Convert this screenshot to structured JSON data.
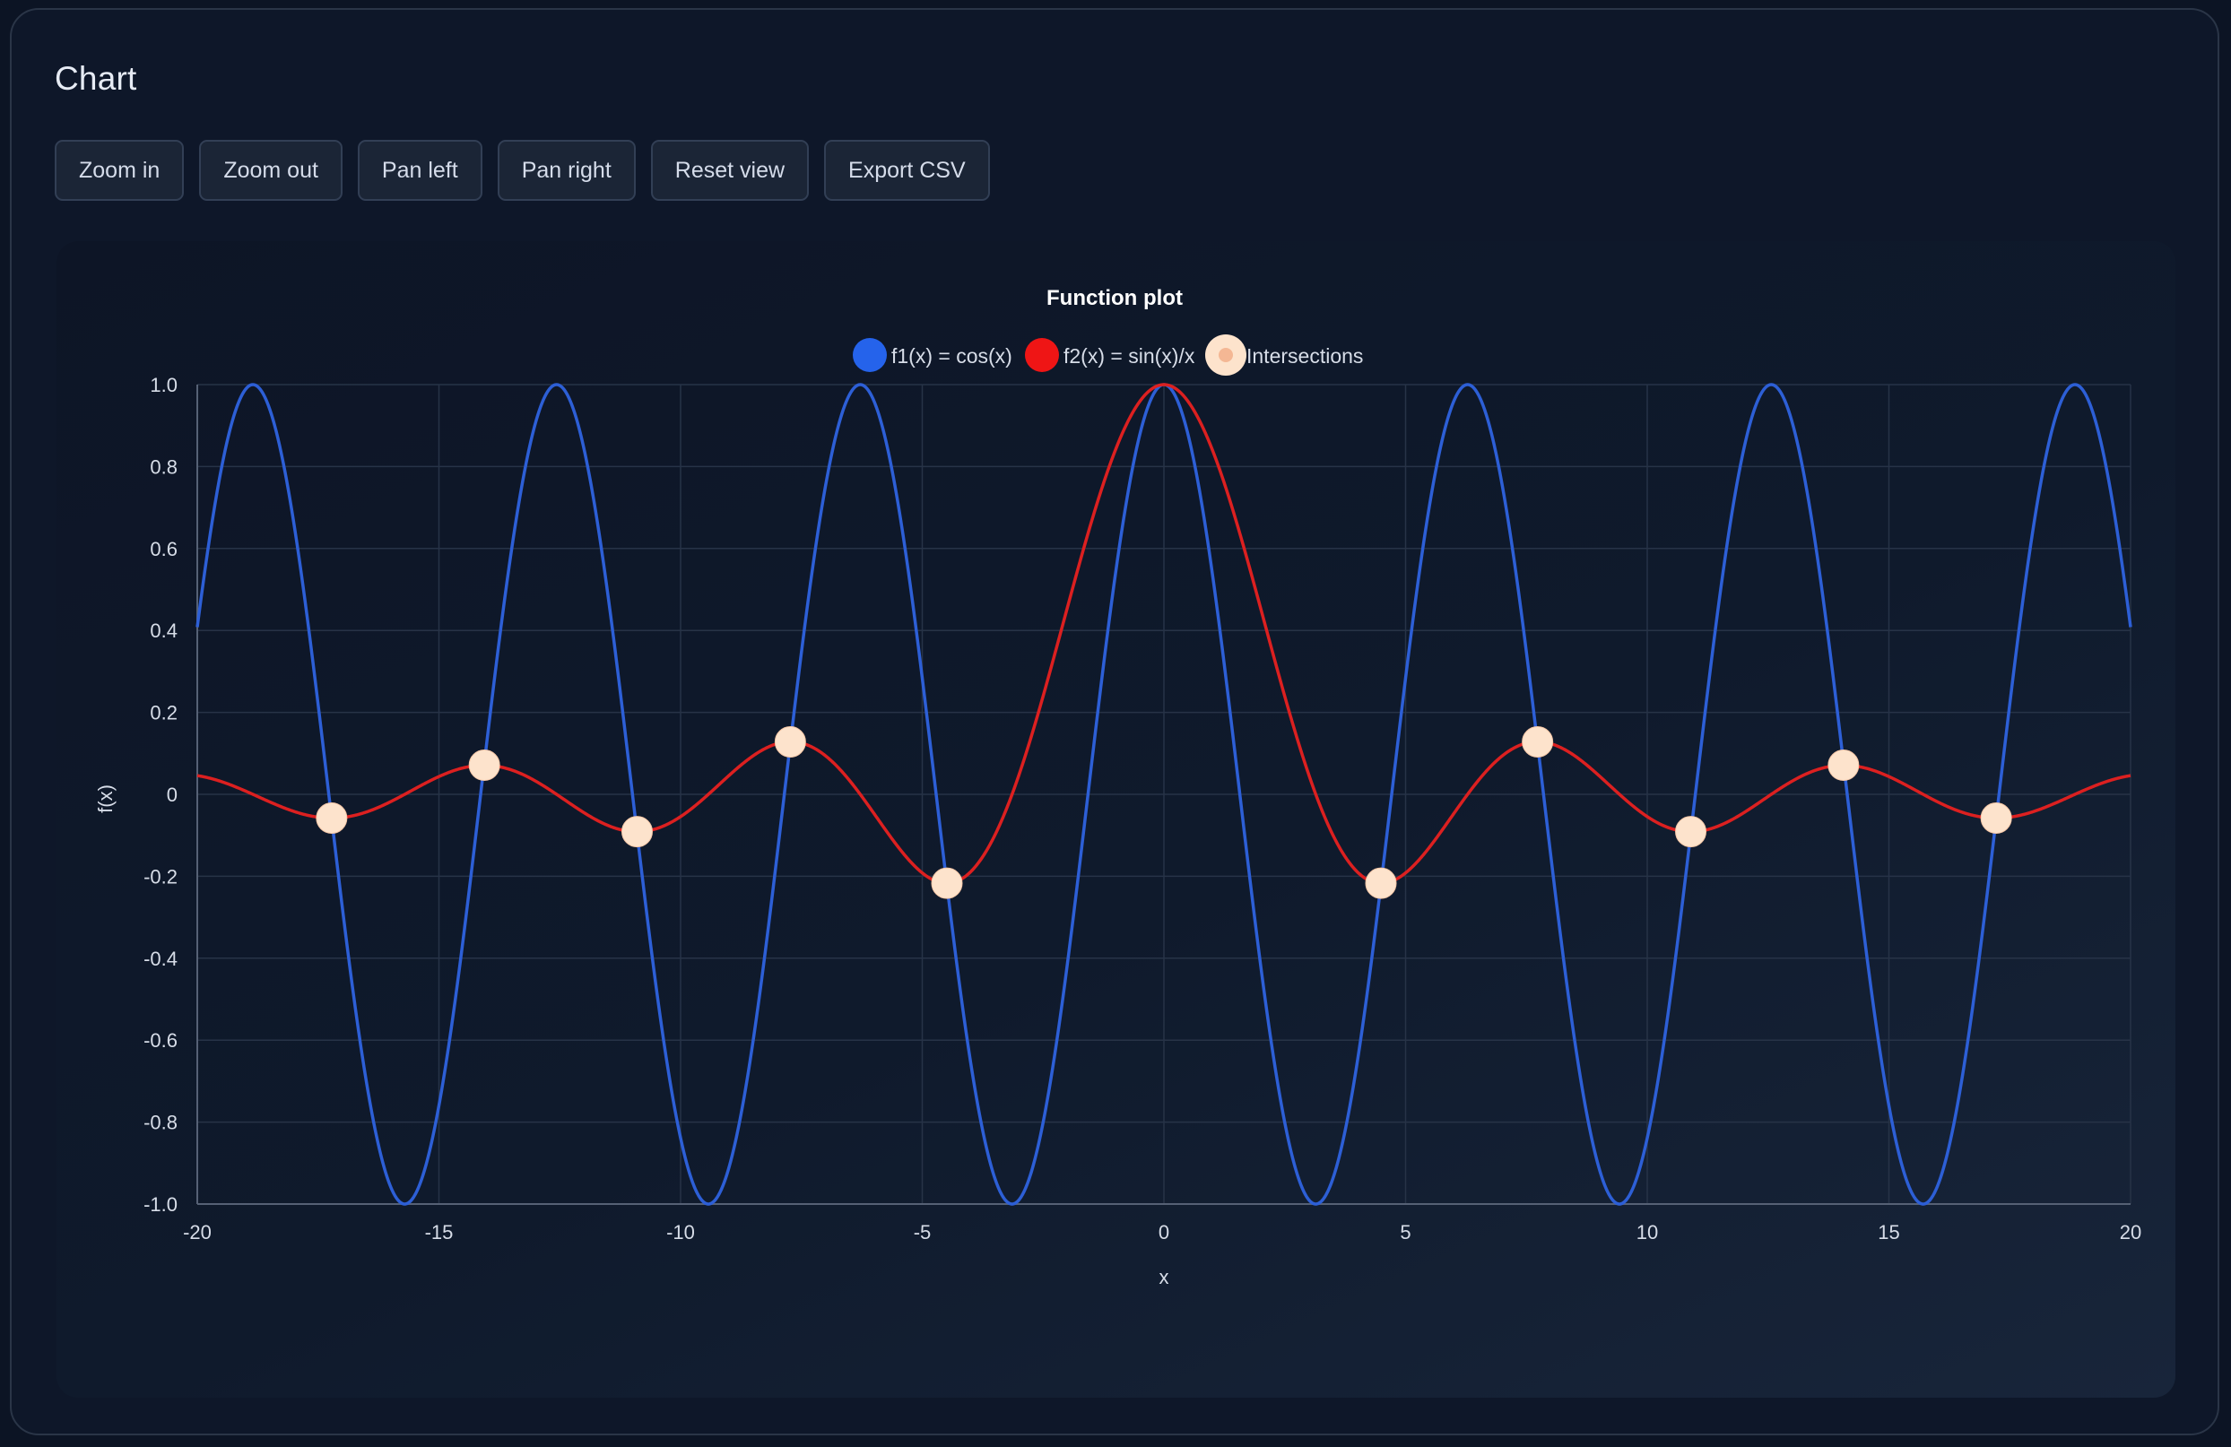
{
  "app": {
    "title": "Chart"
  },
  "toolbar": {
    "buttons": [
      {
        "label": "Zoom in"
      },
      {
        "label": "Zoom out"
      },
      {
        "label": "Pan left"
      },
      {
        "label": "Pan right"
      },
      {
        "label": "Reset view"
      },
      {
        "label": "Export CSV"
      }
    ]
  },
  "colors": {
    "background": "#0c1424",
    "panel": "#0e1729",
    "grid": "#263246",
    "axis": "#5a6578",
    "text": "#d7dde8",
    "f1": "#2d5fd6",
    "f2": "#dc2020",
    "marker": "#fde3cc"
  },
  "chart_data": {
    "type": "line",
    "title": "Function plot",
    "xlabel": "x",
    "ylabel": "f(x)",
    "xlim": [
      -20,
      20
    ],
    "ylim": [
      -1,
      1
    ],
    "x_ticks": [
      -20,
      -15,
      -10,
      -5,
      0,
      5,
      10,
      15,
      20
    ],
    "x_tick_labels": [
      "-20",
      "-15",
      "-10",
      "-5",
      "0",
      "5",
      "10",
      "15",
      "20"
    ],
    "y_ticks": [
      1,
      0.8,
      0.6,
      0.4,
      0.2,
      0,
      -0.2,
      -0.4,
      -0.6,
      -0.8,
      -1
    ],
    "y_tick_labels": [
      "1.0",
      "0.8",
      "0.6",
      "0.4",
      "0.2",
      "0",
      "-0.2",
      "-0.4",
      "-0.6",
      "-0.8",
      "-1.0"
    ],
    "grid": true,
    "legend_position": "top-center",
    "series": [
      {
        "name": "f1(x) = cos(x)",
        "function": "cos(x)",
        "color": "#2d5fd6"
      },
      {
        "name": "f2(x) = sin(x)/x",
        "function": "sin(x)/x",
        "color": "#dc2020"
      },
      {
        "name": "Intersections",
        "type": "scatter",
        "color": "#fde3cc",
        "points": [
          {
            "x": -17.22,
            "y": -0.058
          },
          {
            "x": -14.06,
            "y": 0.071
          },
          {
            "x": -10.9,
            "y": -0.091
          },
          {
            "x": -7.73,
            "y": 0.128
          },
          {
            "x": -4.49,
            "y": -0.217
          },
          {
            "x": 4.49,
            "y": -0.217
          },
          {
            "x": 7.73,
            "y": 0.128
          },
          {
            "x": 10.9,
            "y": -0.091
          },
          {
            "x": 14.06,
            "y": 0.071
          },
          {
            "x": 17.22,
            "y": -0.058
          }
        ]
      }
    ]
  }
}
